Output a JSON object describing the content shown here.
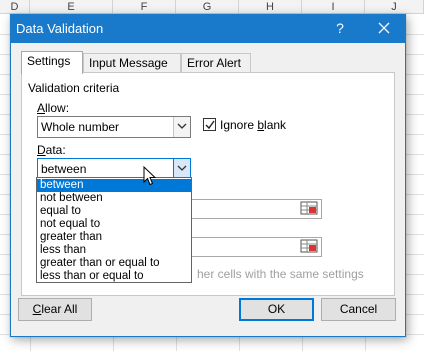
{
  "sheet": {
    "columns": [
      "D",
      "E",
      "F",
      "G",
      "H",
      "I",
      "J"
    ]
  },
  "dialog": {
    "title": "Data Validation",
    "help_glyph": "?",
    "close_glyph": "✕",
    "tabs": [
      "Settings",
      "Input Message",
      "Error Alert"
    ],
    "group_label": "Validation criteria",
    "allow": {
      "label_u": "A",
      "label_rest": "llow:",
      "value": "Whole number"
    },
    "ignore_blank": {
      "label_start": "Ignore ",
      "label_u": "b",
      "label_rest": "lank",
      "checked": true
    },
    "data": {
      "label_u": "D",
      "label_rest": "ata:",
      "value": "between",
      "options": [
        "between",
        "not between",
        "equal to",
        "not equal to",
        "greater than",
        "less than",
        "greater than or equal to",
        "less than or equal to"
      ]
    },
    "apply_all_partial": "her cells with the same settings",
    "buttons": {
      "clear_all_u": "C",
      "clear_all_rest": "lear All",
      "ok": "OK",
      "cancel": "Cancel"
    }
  }
}
